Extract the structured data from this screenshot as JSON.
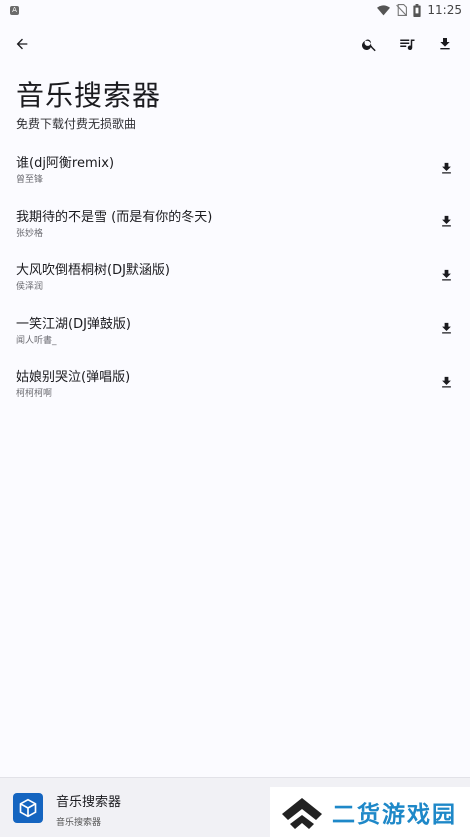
{
  "status_bar": {
    "time": "11:25",
    "icons": [
      "notification-a-icon",
      "wifi-icon",
      "no-sim-icon",
      "battery-icon"
    ]
  },
  "toolbar": {
    "back_icon": "arrow-left-icon",
    "search_icon": "search-icon",
    "playlist_icon": "playlist-music-icon",
    "download_icon": "download-icon"
  },
  "header": {
    "title": "音乐搜索器",
    "subtitle": "免费下载付费无损歌曲"
  },
  "songs": [
    {
      "title": "谁(dj阿衡remix)",
      "artist": "曾至锋"
    },
    {
      "title": "我期待的不是雪 (而是有你的冬天)",
      "artist": "张妙格"
    },
    {
      "title": "大风吹倒梧桐树(DJ默涵版)",
      "artist": "侯泽润"
    },
    {
      "title": "一笑江湖(DJ弹鼓版)",
      "artist": "闻人听書_"
    },
    {
      "title": "姑娘别哭泣(弹唱版)",
      "artist": "柯柯柯啊"
    }
  ],
  "bottom_bar": {
    "app_name": "音乐搜索器",
    "app_sub": "音乐搜索器"
  },
  "watermark": {
    "text": "二货游戏园"
  },
  "colors": {
    "background": "#fbfbff",
    "text": "#1b1b1f",
    "watermark": "#1e88c8",
    "app_icon": "#1565c0"
  }
}
